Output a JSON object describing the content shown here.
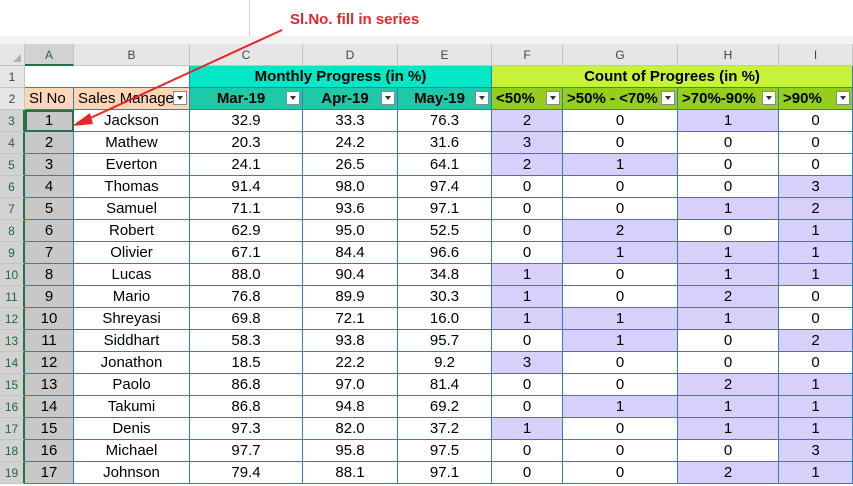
{
  "annotation": "Sl.No. fill in series",
  "columns": [
    "A",
    "B",
    "C",
    "D",
    "E",
    "F",
    "G",
    "H",
    "I"
  ],
  "row_numbers": [
    "1",
    "2",
    "3",
    "4",
    "5",
    "6",
    "7",
    "8",
    "9",
    "10",
    "11",
    "12",
    "13",
    "14",
    "15",
    "16",
    "17",
    "18",
    "19"
  ],
  "group_headers": {
    "monthly": "Monthly Progress (in %)",
    "count": "Count of Progrees (in %)"
  },
  "headers": [
    "Sl No",
    "Sales Manager",
    "Mar-19",
    "Apr-19",
    "May-19",
    "<50%",
    ">50% - <70%",
    ">70%-90%",
    ">90%"
  ],
  "rows": [
    [
      "1",
      "Jackson",
      "32.9",
      "33.3",
      "76.3",
      "2",
      "0",
      "1",
      "0"
    ],
    [
      "2",
      "Mathew",
      "20.3",
      "24.2",
      "31.6",
      "3",
      "0",
      "0",
      "0"
    ],
    [
      "3",
      "Everton",
      "24.1",
      "26.5",
      "64.1",
      "2",
      "1",
      "0",
      "0"
    ],
    [
      "4",
      "Thomas",
      "91.4",
      "98.0",
      "97.4",
      "0",
      "0",
      "0",
      "3"
    ],
    [
      "5",
      "Samuel",
      "71.1",
      "93.6",
      "97.1",
      "0",
      "0",
      "1",
      "2"
    ],
    [
      "6",
      "Robert",
      "62.9",
      "95.0",
      "52.5",
      "0",
      "2",
      "0",
      "1"
    ],
    [
      "7",
      "Olivier",
      "67.1",
      "84.4",
      "96.6",
      "0",
      "1",
      "1",
      "1"
    ],
    [
      "8",
      "Lucas",
      "88.0",
      "90.4",
      "34.8",
      "1",
      "0",
      "1",
      "1"
    ],
    [
      "9",
      "Mario",
      "76.8",
      "89.9",
      "30.3",
      "1",
      "0",
      "2",
      "0"
    ],
    [
      "10",
      "Shreyasi",
      "69.8",
      "72.1",
      "16.0",
      "1",
      "1",
      "1",
      "0"
    ],
    [
      "11",
      "Siddhart",
      "58.3",
      "93.8",
      "95.7",
      "0",
      "1",
      "0",
      "2"
    ],
    [
      "12",
      "Jonathon",
      "18.5",
      "22.2",
      "9.2",
      "3",
      "0",
      "0",
      "0"
    ],
    [
      "13",
      "Paolo",
      "86.8",
      "97.0",
      "81.4",
      "0",
      "0",
      "2",
      "1"
    ],
    [
      "14",
      "Takumi",
      "86.8",
      "94.8",
      "69.2",
      "0",
      "1",
      "1",
      "1"
    ],
    [
      "15",
      "Denis",
      "97.3",
      "82.0",
      "37.2",
      "1",
      "0",
      "1",
      "1"
    ],
    [
      "16",
      "Michael",
      "97.7",
      "95.8",
      "97.5",
      "0",
      "0",
      "0",
      "3"
    ],
    [
      "17",
      "Johnson",
      "79.4",
      "88.1",
      "97.1",
      "0",
      "0",
      "2",
      "1"
    ]
  ],
  "colors": {
    "monthly_header": "#00e8c6",
    "count_header": "#c6f23a",
    "highlight": "#d6d0fa",
    "annotation": "#e8262a"
  }
}
